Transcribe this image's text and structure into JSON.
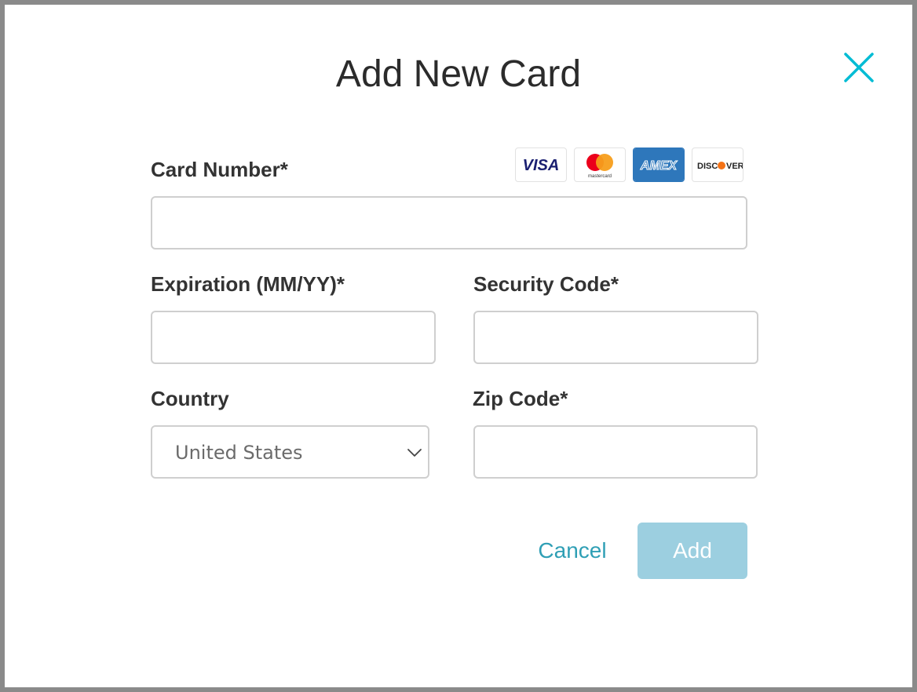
{
  "modal": {
    "title": "Add New Card",
    "close_icon": "close-icon"
  },
  "card_number": {
    "label": "Card Number*",
    "value": "",
    "placeholder": ""
  },
  "card_logos": [
    {
      "name": "VISA",
      "icon": "visa-logo"
    },
    {
      "name": "mastercard",
      "icon": "mastercard-logo"
    },
    {
      "name": "AMEX",
      "icon": "amex-logo"
    },
    {
      "name": "DISCOVER",
      "icon": "discover-logo"
    }
  ],
  "expiration": {
    "label": "Expiration (MM/YY)*",
    "value": "",
    "placeholder": ""
  },
  "security_code": {
    "label": "Security Code*",
    "value": "",
    "placeholder": ""
  },
  "country": {
    "label": "Country",
    "selected": "United States",
    "chevron_icon": "chevron-down-icon"
  },
  "zip_code": {
    "label": "Zip Code*",
    "value": "",
    "placeholder": ""
  },
  "actions": {
    "cancel_label": "Cancel",
    "add_label": "Add"
  },
  "colors": {
    "accent": "#00bcd4",
    "link": "#2f9fb5",
    "add_button_disabled": "#9ccfe0",
    "amex_blue": "#2e77bb",
    "visa_blue": "#1a1f71",
    "discover_orange": "#f47216"
  }
}
